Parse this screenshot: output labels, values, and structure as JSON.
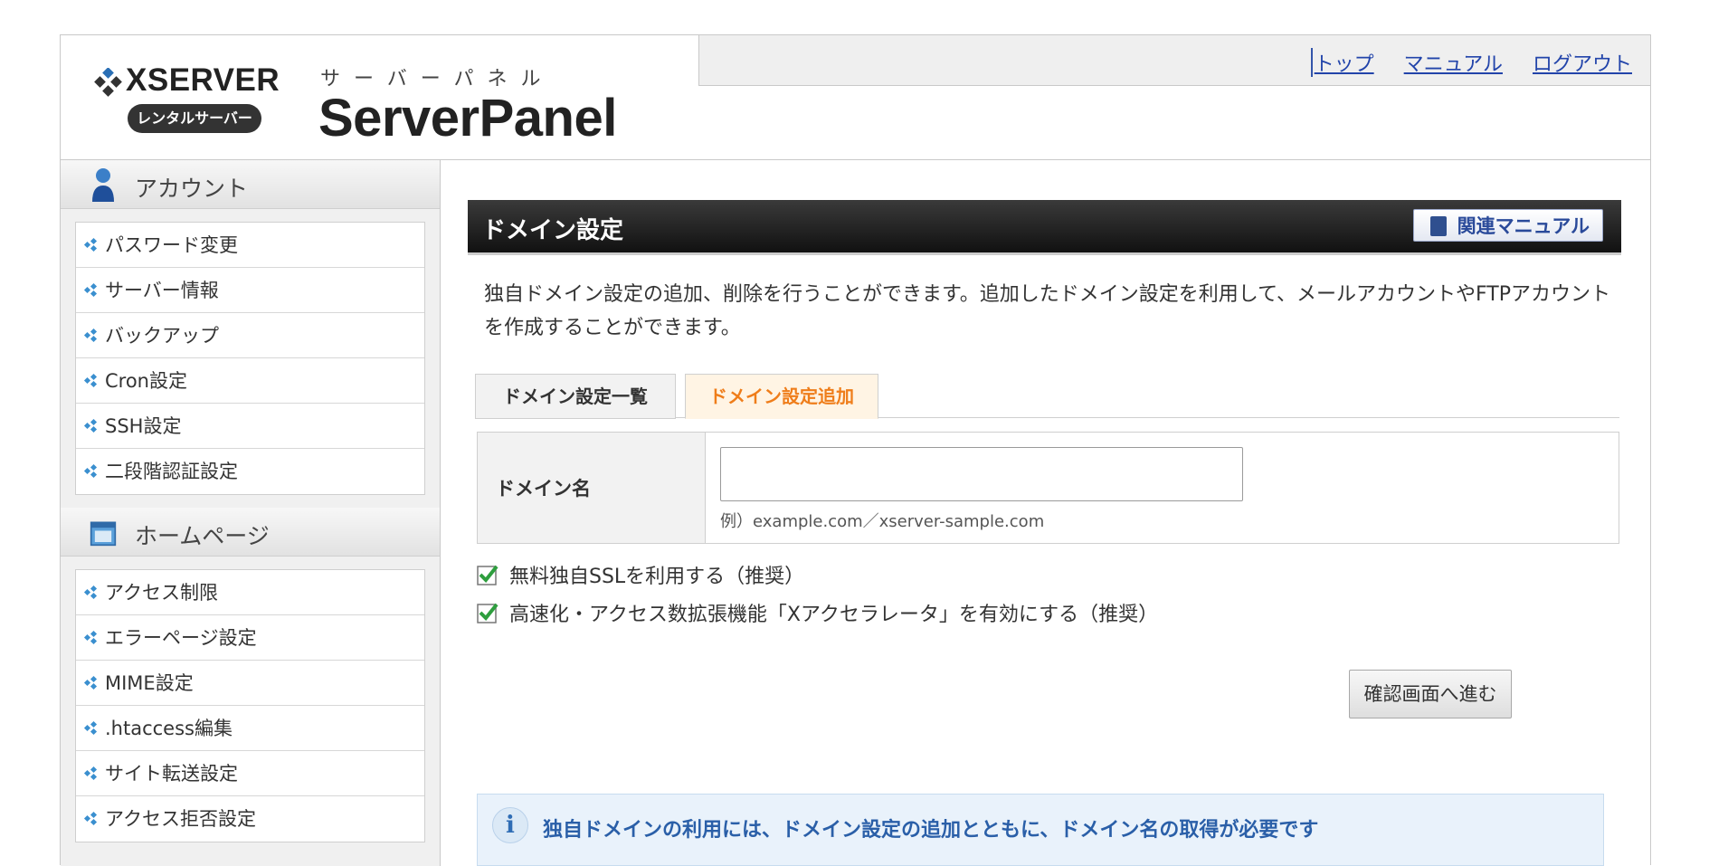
{
  "brand": {
    "logo_word": "XSERVER",
    "logo_tag": "レンタルサーバー",
    "panel_sub": "サーバーパネル",
    "panel_name": "ServerPanel"
  },
  "topnav": {
    "items": [
      "トップ",
      "マニュアル",
      "ログアウト"
    ]
  },
  "sidebar": {
    "sections": [
      {
        "title": "アカウント",
        "icon": "user-icon",
        "items": [
          "パスワード変更",
          "サーバー情報",
          "バックアップ",
          "Cron設定",
          "SSH設定",
          "二段階認証設定"
        ]
      },
      {
        "title": "ホームページ",
        "icon": "window-icon",
        "items": [
          "アクセス制限",
          "エラーページ設定",
          "MIME設定",
          ".htaccess編集",
          "サイト転送設定",
          "アクセス拒否設定"
        ]
      }
    ]
  },
  "main": {
    "title": "ドメイン設定",
    "manual_button": "関連マニュアル",
    "description": "独自ドメイン設定の追加、削除を行うことができます。追加したドメイン設定を利用して、メールアカウントやFTPアカウントを作成することができます。",
    "tabs": [
      {
        "label": "ドメイン設定一覧",
        "active": false
      },
      {
        "label": "ドメイン設定追加",
        "active": true
      }
    ],
    "form": {
      "label": "ドメイン名",
      "value": "",
      "hint": "例）example.com／xserver-sample.com"
    },
    "options": [
      {
        "label": "無料独自SSLを利用する（推奨）",
        "checked": true
      },
      {
        "label": "高速化・アクセス数拡張機能「Xアクセラレータ」を有効にする（推奨）",
        "checked": true
      }
    ],
    "confirm_button": "確認画面へ進む",
    "info": "独自ドメインの利用には、ドメイン設定の追加とともに、ドメイン名の取得が必要です"
  },
  "colors": {
    "accent_orange": "#ef7d1a",
    "link_blue": "#2244aa",
    "check_green": "#2e9e3e"
  }
}
